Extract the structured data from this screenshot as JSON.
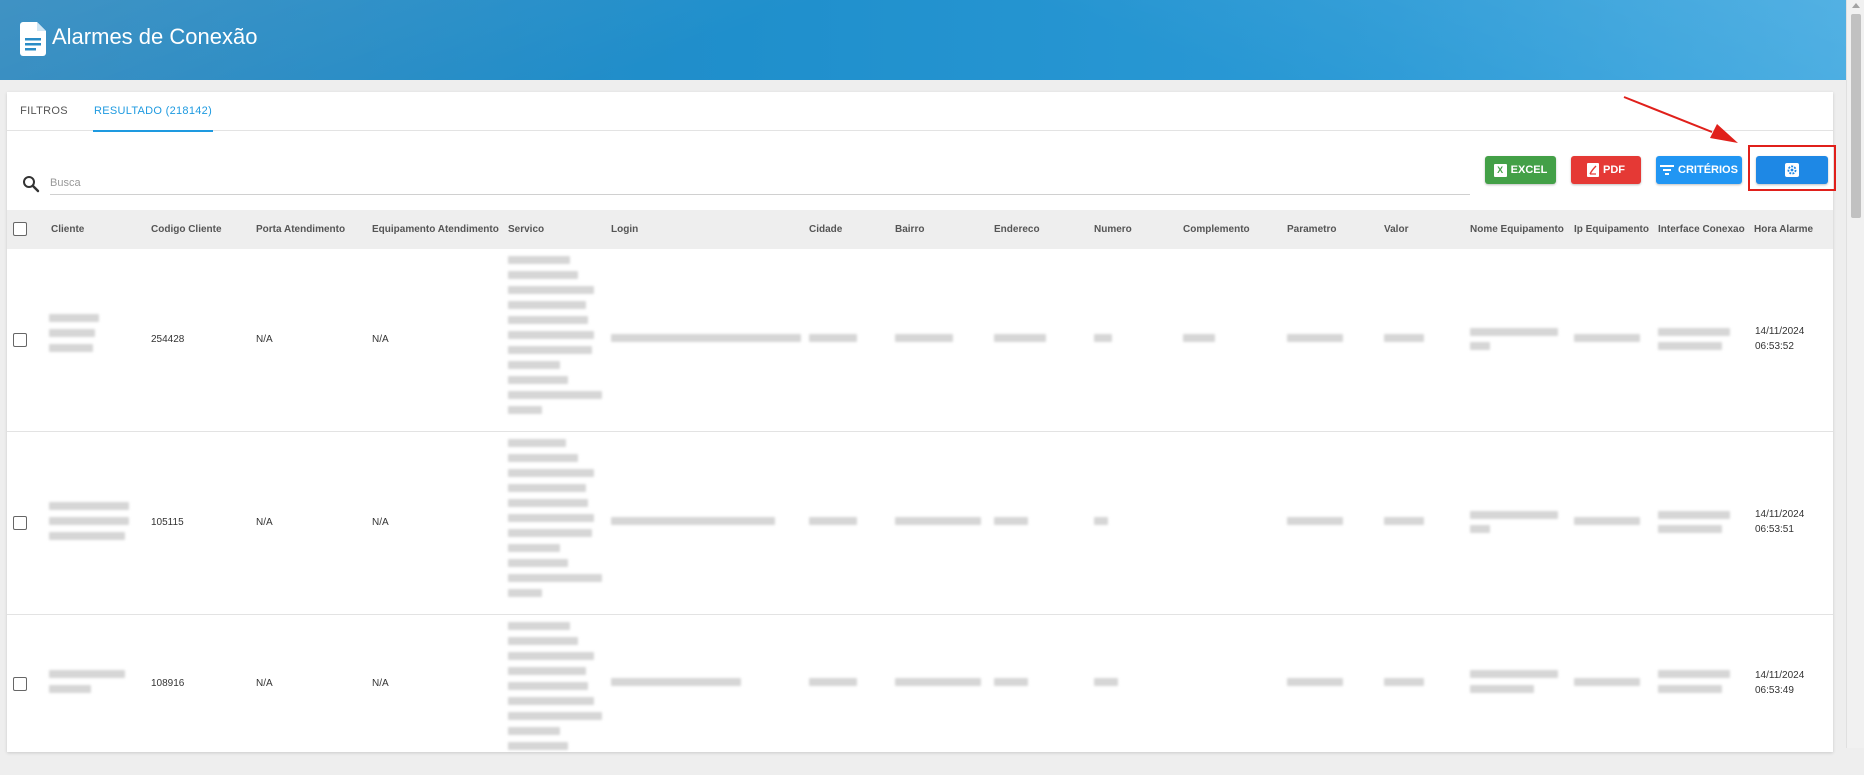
{
  "header": {
    "title": "Alarmes de Conexão"
  },
  "tabs": [
    {
      "label": "FILTROS"
    },
    {
      "label": "RESULTADO (218142)"
    }
  ],
  "search": {
    "placeholder": "Busca",
    "value": ""
  },
  "toolbar": {
    "excel_label": "EXCEL",
    "pdf_label": "PDF",
    "criteria_label": "CRITÉRIOS"
  },
  "table": {
    "columns": [
      "Cliente",
      "Codigo Cliente",
      "Porta Atendimento",
      "Equipamento Atendimento",
      "Servico",
      "Login",
      "Cidade",
      "Bairro",
      "Endereco",
      "Numero",
      "Complemento",
      "Parametro",
      "Valor",
      "Nome Equipamento",
      "Ip Equipamento",
      "Interface Conexao",
      "Hora Alarme"
    ],
    "rows": [
      {
        "codigo_cliente": "254428",
        "porta_atendimento": "N/A",
        "equipamento_atendimento": "N/A",
        "hora_date": "14/11/2024",
        "hora_time": "06:53:52"
      },
      {
        "codigo_cliente": "105115",
        "porta_atendimento": "N/A",
        "equipamento_atendimento": "N/A",
        "hora_date": "14/11/2024",
        "hora_time": "06:53:51"
      },
      {
        "codigo_cliente": "108916",
        "porta_atendimento": "N/A",
        "equipamento_atendimento": "N/A",
        "hora_date": "14/11/2024",
        "hora_time": "06:53:49"
      }
    ]
  },
  "colors": {
    "accent": "#1e9ae0",
    "excel": "#43a047",
    "pdf": "#e53935",
    "criteria": "#2196f3",
    "annotation": "#e0201b"
  }
}
